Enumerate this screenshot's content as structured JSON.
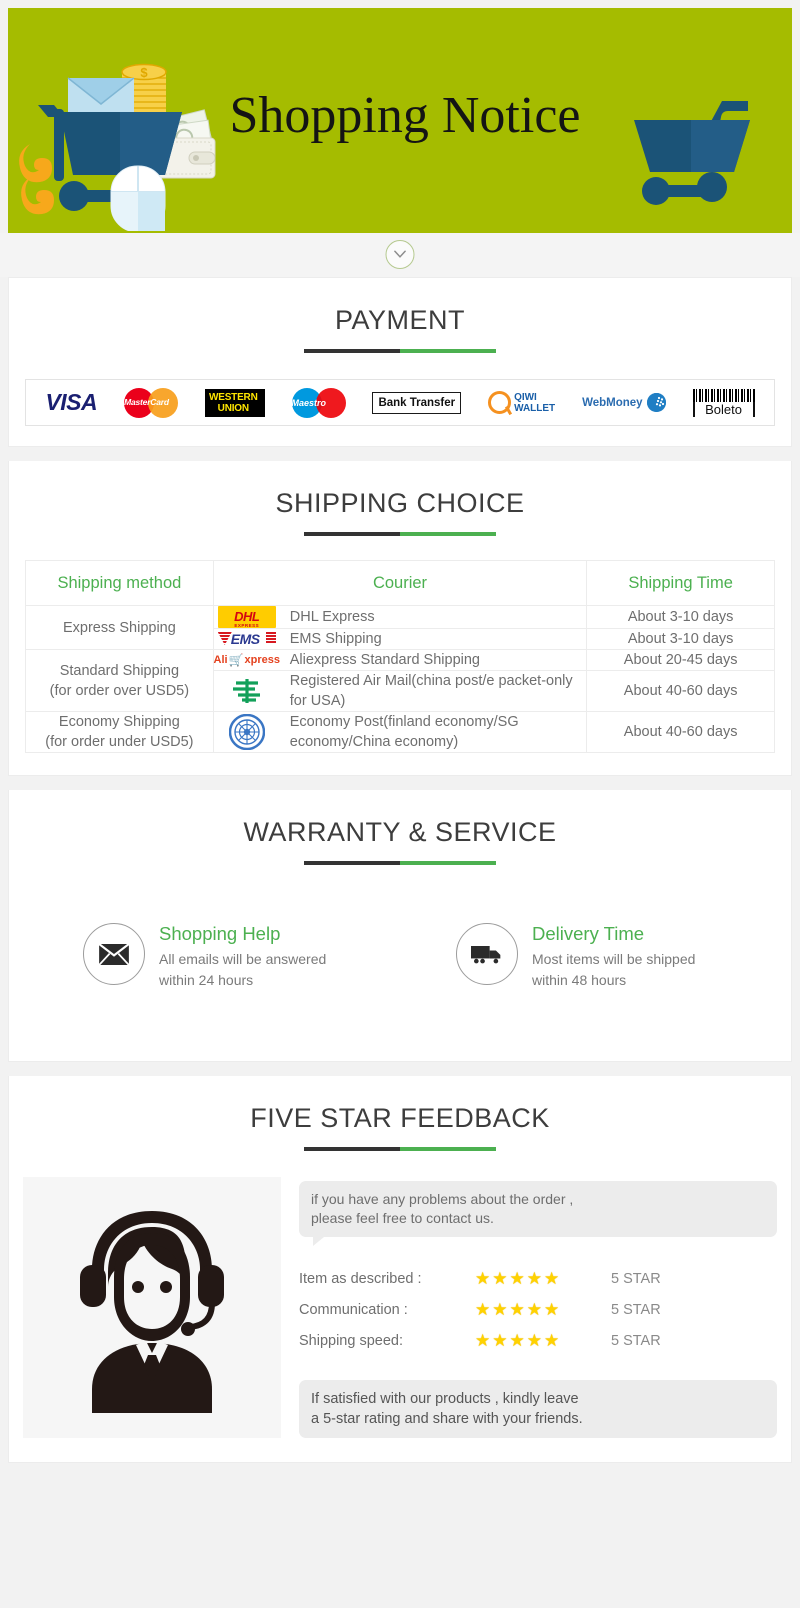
{
  "banner": {
    "title": "Shopping Notice",
    "bg_color": "#a5bc00",
    "left_illustration": "shopping-cart-mail-money-illustration",
    "right_illustration": "shopping-cart-illustration"
  },
  "divider": {
    "icon": "chevron-down-circle-icon"
  },
  "payment": {
    "title": "PAYMENT",
    "methods": [
      {
        "name": "visa",
        "label": "VISA"
      },
      {
        "name": "mastercard",
        "label": "MasterCard"
      },
      {
        "name": "western-union",
        "line1": "WESTERN",
        "line2": "UNION"
      },
      {
        "name": "maestro",
        "label": "Maestro"
      },
      {
        "name": "bank-transfer",
        "label": "Bank Transfer"
      },
      {
        "name": "qiwi-wallet",
        "line1": "QIWI",
        "line2": "WALLET"
      },
      {
        "name": "webmoney",
        "label": "WebMoney"
      },
      {
        "name": "boleto",
        "label": "Boleto"
      }
    ]
  },
  "shipping": {
    "title": "SHIPPING CHOICE",
    "headers": [
      "Shipping method",
      "Courier",
      "Shipping Time"
    ],
    "groups": [
      {
        "method": "Express Shipping",
        "rows": [
          {
            "logo": "dhl-logo",
            "courier": "DHL Express",
            "time": "About 3-10 days"
          },
          {
            "logo": "ems-logo",
            "courier": "EMS Shipping",
            "time": "About 3-10 days"
          }
        ]
      },
      {
        "method": "Standard Shipping\n(for order over USD5)",
        "method_line1": "Standard Shipping",
        "method_line2": "(for order over USD5)",
        "rows": [
          {
            "logo": "aliexpress-logo",
            "courier": "Aliexpress Standard Shipping",
            "time": "About 20-45 days"
          },
          {
            "logo": "china-post-logo",
            "courier": "Registered Air Mail(china post/e packet-only for USA)",
            "time": "About 40-60 days"
          }
        ]
      },
      {
        "method": "Economy Shipping\n(for order under USD5)",
        "method_line1": "Economy Shipping",
        "method_line2": "(for order under USD5)",
        "rows": [
          {
            "logo": "united-nations-logo",
            "courier": "Economy Post(finland economy/SG economy/China economy)",
            "time": "About 40-60 days"
          }
        ]
      }
    ]
  },
  "warranty": {
    "title": "WARRANTY & SERVICE",
    "items": [
      {
        "icon": "envelope-icon",
        "heading": "Shopping Help",
        "line1": "All emails will be answered",
        "line2": "within 24 hours"
      },
      {
        "icon": "truck-icon",
        "heading": "Delivery Time",
        "line1": "Most items will be shipped",
        "line2": "within 48 hours"
      }
    ]
  },
  "feedback": {
    "title": "FIVE STAR FEEDBACK",
    "agent_illustration": "customer-service-agent-icon",
    "bubble_top_line1": "if you have any problems about the order ,",
    "bubble_top_line2": "please feel free to contact us.",
    "ratings": [
      {
        "label": "Item as described :",
        "stars": 5,
        "value": "5 STAR"
      },
      {
        "label": "Communication :",
        "stars": 5,
        "value": "5 STAR"
      },
      {
        "label": "Shipping speed:",
        "stars": 5,
        "value": "5 STAR"
      }
    ],
    "bubble_bottom_line1": "If satisfied with our products ,  kindly leave",
    "bubble_bottom_line2": "a 5-star rating and share with your friends."
  },
  "colors": {
    "banner_green": "#a5bc00",
    "accent_green": "#4cb050",
    "title_dark": "#3d3d3d",
    "body_gray": "#6e6e6e"
  }
}
